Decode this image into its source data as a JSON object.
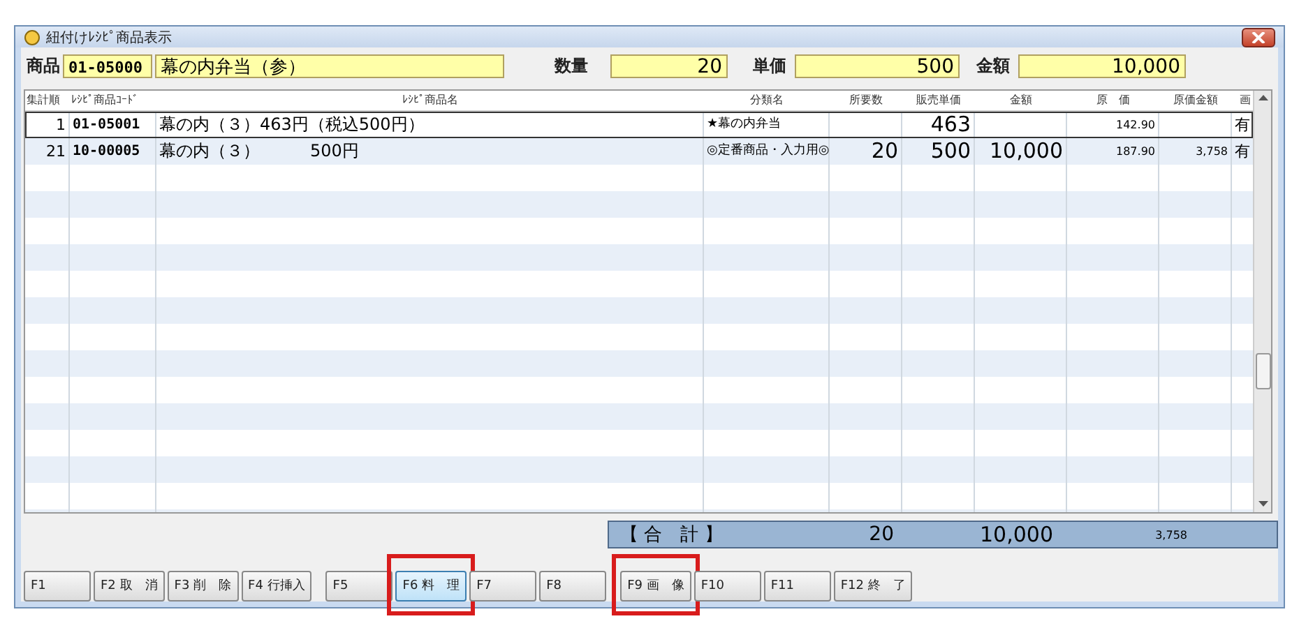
{
  "window": {
    "title": "紐付けﾚｼﾋﾟ商品表示"
  },
  "header": {
    "product_label": "商品",
    "product_code": "01-05000",
    "product_name": "幕の内弁当（参）",
    "qty_label": "数量",
    "qty": "20",
    "price_label": "単価",
    "price": "500",
    "amount_label": "金額",
    "amount": "10,000"
  },
  "table": {
    "columns": [
      "集計順",
      "ﾚｼﾋﾟ商品ｺｰﾄﾞ",
      "ﾚｼﾋﾟ商品名",
      "分類名",
      "所要数",
      "販売単価",
      "金額",
      "原　価",
      "原価金額",
      "画"
    ],
    "rows": [
      {
        "selected": true,
        "cells": [
          "1",
          "01-05001",
          "幕の内（３）463円（税込500円）",
          "★幕の内弁当",
          "",
          "463",
          "",
          "142.90",
          "",
          "有"
        ]
      },
      {
        "selected": false,
        "cells": [
          "21",
          "10-00005",
          "幕の内（３）　　　500円",
          "◎定番商品・入力用◎",
          "20",
          "500",
          "10,000",
          "187.90",
          "3,758",
          "有"
        ]
      }
    ]
  },
  "total": {
    "label": "【 合　計 】",
    "qty": "20",
    "amount": "10,000",
    "cost_amount": "3,758"
  },
  "buttons": [
    {
      "label": "F1",
      "selected": false,
      "highlighted": false
    },
    {
      "label": "F2 取　消",
      "selected": false,
      "highlighted": false
    },
    {
      "label": "F3 削　除",
      "selected": false,
      "highlighted": false
    },
    {
      "label": "F4 行挿入",
      "selected": false,
      "highlighted": false
    },
    {
      "label": "F5",
      "selected": false,
      "highlighted": false
    },
    {
      "label": "F6 料　理",
      "selected": true,
      "highlighted": true
    },
    {
      "label": "F7",
      "selected": false,
      "highlighted": false
    },
    {
      "label": "F8",
      "selected": false,
      "highlighted": false
    },
    {
      "label": "F9 画　像",
      "selected": false,
      "highlighted": true
    },
    {
      "label": "F10",
      "selected": false,
      "highlighted": false
    },
    {
      "label": "F11",
      "selected": false,
      "highlighted": false
    },
    {
      "label": "F12 終　了",
      "selected": false,
      "highlighted": false
    }
  ]
}
